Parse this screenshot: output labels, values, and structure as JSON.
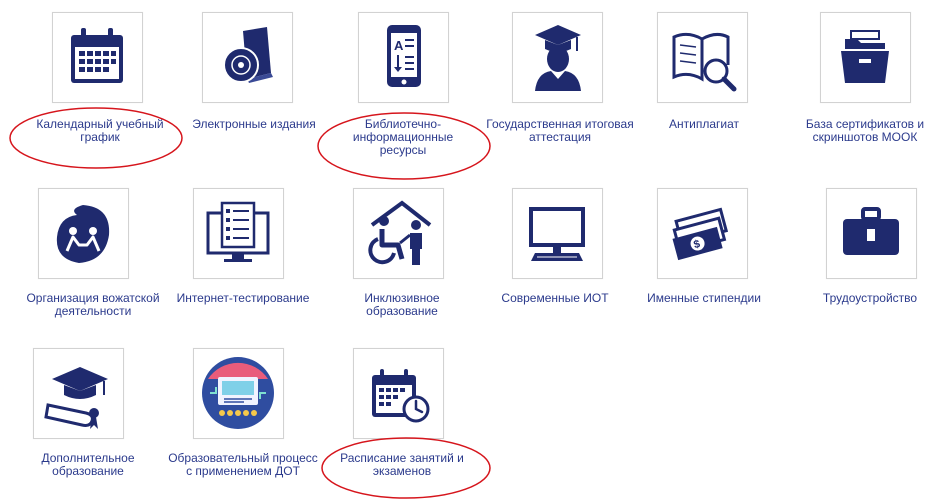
{
  "tiles": [
    {
      "label": "Календарный учебный график",
      "icon": "calendar-icon"
    },
    {
      "label": "Электронные издания",
      "icon": "book-disc-icon"
    },
    {
      "label": "Библиотечно-информационные ресурсы",
      "icon": "ebook-reader-icon"
    },
    {
      "label": "Государственная итоговая аттестация",
      "icon": "graduate-icon"
    },
    {
      "label": "Антиплагиат",
      "icon": "book-magnifier-icon"
    },
    {
      "label": "База сертификатов и скриншотов МООК",
      "icon": "file-cabinet-icon"
    },
    {
      "label": "Организация вожатской деятельности",
      "icon": "counselor-logo-icon"
    },
    {
      "label": "Интернет-тестирование",
      "icon": "online-test-icon"
    },
    {
      "label": "Инклюзивное образование",
      "icon": "inclusive-icon"
    },
    {
      "label": "Современные ИОТ",
      "icon": "monitor-icon"
    },
    {
      "label": "Именные стипендии",
      "icon": "money-icon"
    },
    {
      "label": "Трудоустройство",
      "icon": "briefcase-icon"
    },
    {
      "label": "Дополнительное образование",
      "icon": "diploma-cap-icon"
    },
    {
      "label": "Образовательный процесс с применением ДОТ",
      "icon": "distance-learning-icon"
    },
    {
      "label": "Расписание занятий и экзаменов",
      "icon": "schedule-clock-icon"
    }
  ],
  "colors": {
    "icon": "#1f2a6e",
    "label": "#2b3a8c",
    "highlight": "#d6151c"
  }
}
